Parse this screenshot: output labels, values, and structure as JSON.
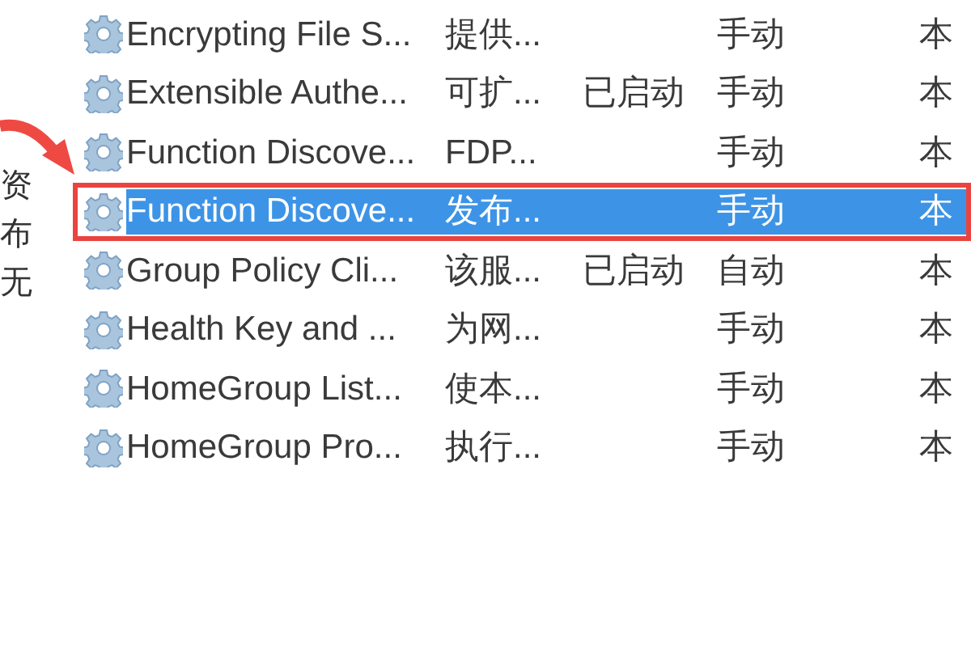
{
  "side_fragments": [
    "资",
    "布",
    "无"
  ],
  "services": [
    {
      "name": "Encrypting File S...",
      "description": "提供...",
      "startup": "手动",
      "logon": "本",
      "selected": false
    },
    {
      "name": "Extensible Authe...",
      "description": "可扩...",
      "status": "已启动",
      "startup": "手动",
      "logon": "本",
      "selected": false
    },
    {
      "name": "Function Discove...",
      "description": "FDP...",
      "startup": "手动",
      "logon": "本",
      "selected": false
    },
    {
      "name": "Function Discove...",
      "description": "发布...",
      "startup": "手动",
      "logon": "本",
      "selected": true
    },
    {
      "name": "Group Policy Cli...",
      "description": "该服...",
      "status": "已启动",
      "startup": "自动",
      "logon": "本",
      "selected": false
    },
    {
      "name": "Health Key and ...",
      "description": "为网...",
      "startup": "手动",
      "logon": "本",
      "selected": false
    },
    {
      "name": "HomeGroup List...",
      "description": "使本...",
      "startup": "手动",
      "logon": "本",
      "selected": false
    },
    {
      "name": "HomeGroup Pro...",
      "description": "执行...",
      "startup": "手动",
      "logon": "本",
      "selected": false
    }
  ]
}
